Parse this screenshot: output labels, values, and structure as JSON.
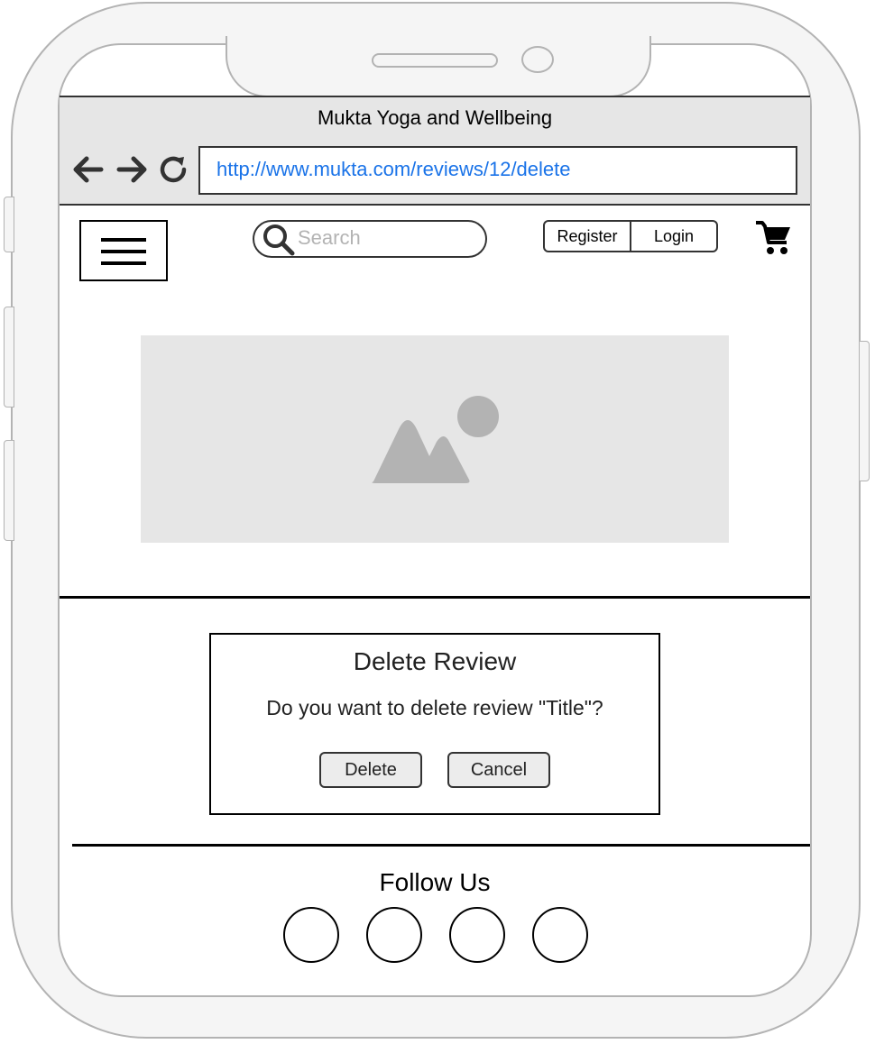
{
  "browser": {
    "title": "Mukta Yoga and Wellbeing",
    "url": "http://www.mukta.com/reviews/12/delete",
    "url_color": "#1a73e8"
  },
  "header": {
    "search_placeholder": "Search",
    "register_label": "Register",
    "login_label": "Login"
  },
  "dialog": {
    "title": "Delete Review",
    "message": "Do you want to delete review \"Title\"?",
    "delete_label": "Delete",
    "cancel_label": "Cancel"
  },
  "footer": {
    "follow_label": "Follow Us",
    "social_links": [
      "social-link",
      "social-link",
      "social-link",
      "social-link"
    ]
  },
  "icons": [
    "back-arrow-icon",
    "forward-arrow-icon",
    "reload-icon",
    "hamburger-menu-icon",
    "search-icon",
    "shopping-cart-icon",
    "image-placeholder-icon"
  ]
}
